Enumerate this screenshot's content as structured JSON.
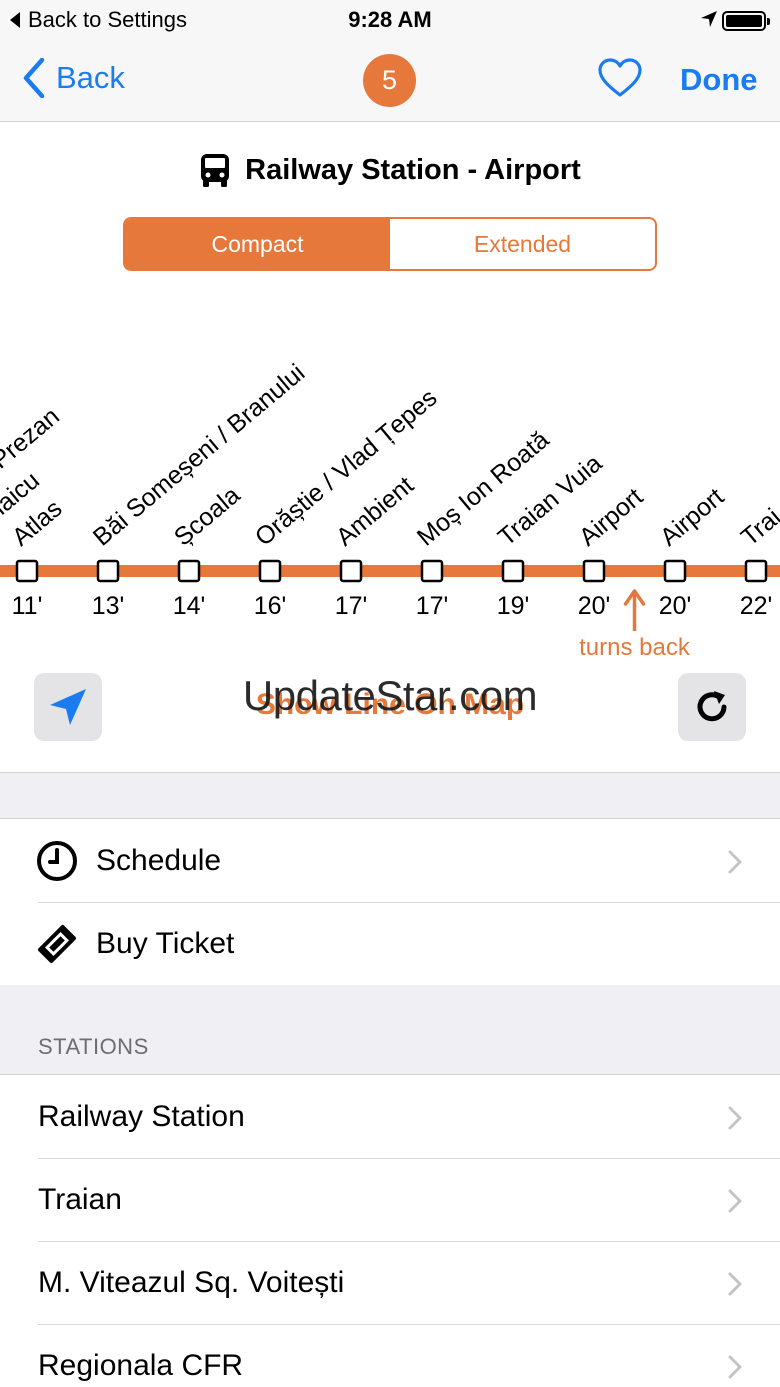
{
  "status_bar": {
    "back_app": "Back to Settings",
    "time": "9:28 AM"
  },
  "nav": {
    "back_label": "Back",
    "badge": "5",
    "done_label": "Done"
  },
  "route": {
    "title": "Railway Station - Airport",
    "icon": "bus-icon"
  },
  "view_mode": {
    "options": [
      "Compact",
      "Extended"
    ],
    "selected": "Compact"
  },
  "line": {
    "color": "#e5783a",
    "stops": [
      {
        "name": "Atlas",
        "time": "11'",
        "extra": [
          "ui / Aurel Vlaicu",
          "C. Prezan"
        ]
      },
      {
        "name": "Băi Someșeni / Branului",
        "time": "13'"
      },
      {
        "name": "Școala",
        "time": "14'"
      },
      {
        "name": "Orăștie / Vlad Țepes",
        "time": "16'"
      },
      {
        "name": "Ambient",
        "time": "17'"
      },
      {
        "name": "Moș Ion Roată",
        "time": "17'"
      },
      {
        "name": "Traian Vuia",
        "time": "19'"
      },
      {
        "name": "Airport",
        "time": "20'"
      },
      {
        "name": "Airport",
        "time": "20'"
      },
      {
        "name": "Trai",
        "time": "22'"
      }
    ],
    "turns_back_label": "turns back"
  },
  "controls": {
    "locate_icon": "location-arrow-icon",
    "show_map_label": "Show Line On Map",
    "refresh_icon": "refresh-icon",
    "watermark": "UpdateStar.com"
  },
  "actions": [
    {
      "label": "Schedule",
      "icon": "clock-icon"
    },
    {
      "label": "Buy Ticket",
      "icon": "ticket-icon"
    }
  ],
  "stations_section": {
    "header": "STATIONS",
    "items": [
      "Railway Station",
      "Traian",
      "M. Viteazul Sq. Voitești",
      "Regionala CFR"
    ]
  },
  "colors": {
    "accent": "#e5783a",
    "link": "#1a7cf0"
  }
}
